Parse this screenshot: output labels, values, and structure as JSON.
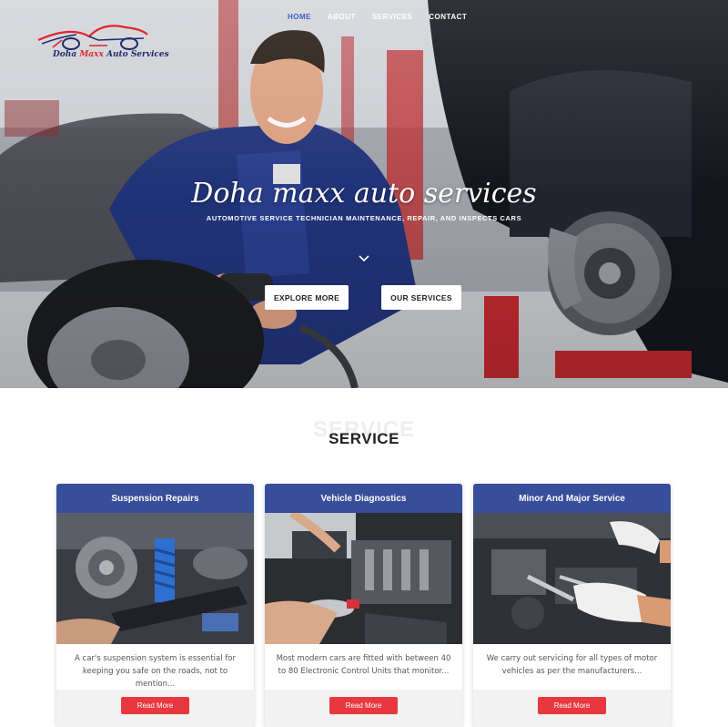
{
  "brand": {
    "logo_text_part1": "Doha ",
    "logo_text_part2": "Maxx",
    "logo_text_part3": " Auto Services",
    "logo_icon": "car-outline-logo"
  },
  "nav": {
    "items": [
      {
        "label": "HOME",
        "active": true
      },
      {
        "label": "ABOUT",
        "active": false
      },
      {
        "label": "SERVICES",
        "active": false
      },
      {
        "label": "CONTACT",
        "active": false
      }
    ]
  },
  "hero": {
    "title": "Doha maxx auto services",
    "subtitle": "AUTOMOTIVE SERVICE TECHNICIAN MAINTENANCE, REPAIR, AND INSPECTS CARS",
    "scroll_icon": "chevron-down-icon",
    "buttons": {
      "explore": "EXPLORE MORE",
      "services": "OUR SERVICES"
    }
  },
  "services": {
    "ghost_title": "SERVICE",
    "title": "SERVICE",
    "cards": [
      {
        "title": "Suspension Repairs",
        "text": "A car's suspension system is essential for keeping you safe on the roads, not to mention...",
        "button": "Read More"
      },
      {
        "title": "Vehicle Diagnostics",
        "text": "Most modern cars are fitted with between 40 to 80 Electronic Control Units that monitor...",
        "button": "Read More"
      },
      {
        "title": "Minor And Major Service",
        "text": "We carry out servicing for all types of motor vehicles as per the manufacturers...",
        "button": "Read More"
      }
    ]
  },
  "colors": {
    "nav_active": "#3b63c7",
    "card_header": "#374e9a",
    "read_more": "#e8383f",
    "logo_blue": "#1f2d6b",
    "logo_red": "#e0262d"
  }
}
